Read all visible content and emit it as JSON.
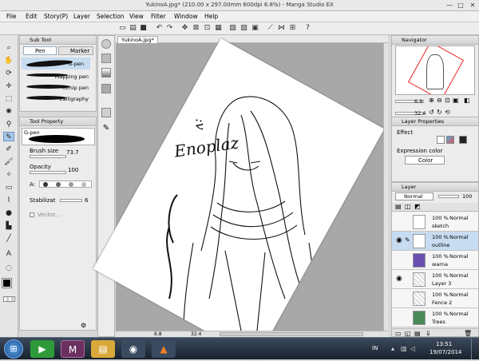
{
  "window": {
    "title": "YukinoA.jpg* (210.00 x 297.00mm 600dpi 6.8%) - Manga Studio EX",
    "minimize": "—",
    "maximize": "□",
    "close": "✕"
  },
  "menu": [
    "File",
    "Edit",
    "Story(P)",
    "Layer",
    "Selection",
    "View",
    "Filter",
    "Window",
    "Help"
  ],
  "document": {
    "tab": "YukinoA.jpg*"
  },
  "subtool": {
    "header": "Sub Tool",
    "tabs": [
      "Pen",
      "Marker"
    ],
    "brushes": [
      "G-pen",
      "Mapping pen",
      "Turnip pen",
      "Calligraphy"
    ]
  },
  "toolprop": {
    "header": "Tool Property",
    "brush_name": "G-pen",
    "brush_size_label": "Brush size",
    "brush_size_value": "73.7",
    "opacity_label": "Opacity",
    "opacity_value": "100",
    "aa_label": "A:",
    "stabilization_label": "Stabilizat",
    "stabilization_value": "6",
    "vector_label": "Vector..."
  },
  "navigator": {
    "header": "Navigator",
    "zoom_value": "6.8",
    "rotation_value": "32.4"
  },
  "layerprop": {
    "header": "Layer Properties",
    "effect_label": "Effect",
    "expression_color_label": "Expression color",
    "expression_color_value": "Color"
  },
  "layers": {
    "header": "Layer",
    "blend_mode": "Normal",
    "opacity": "100",
    "items": [
      {
        "percent": "100 %",
        "mode": "Normal",
        "name": "sketch"
      },
      {
        "percent": "100 %",
        "mode": "Normal",
        "name": "outline"
      },
      {
        "percent": "100 %",
        "mode": "Normal",
        "name": "warna"
      },
      {
        "percent": "100 %",
        "mode": "Normal",
        "name": "Layer 3"
      },
      {
        "percent": "100 %",
        "mode": "Normal",
        "name": "Fence 2"
      },
      {
        "percent": "100 %",
        "mode": "Normal",
        "name": "Trees"
      }
    ]
  },
  "statusbar": {
    "zoom": "6.8",
    "angle": "32.4"
  },
  "artwork": {
    "text": "Enoplaz",
    "eyes": ":v"
  },
  "taskbar": {
    "lang": "IN",
    "time": "13:51",
    "date": "19/07/2014"
  },
  "colors": {
    "accent": "#a8c8e8",
    "taskbar": "#18222e",
    "canvas_bg": "#a8a8a8"
  }
}
